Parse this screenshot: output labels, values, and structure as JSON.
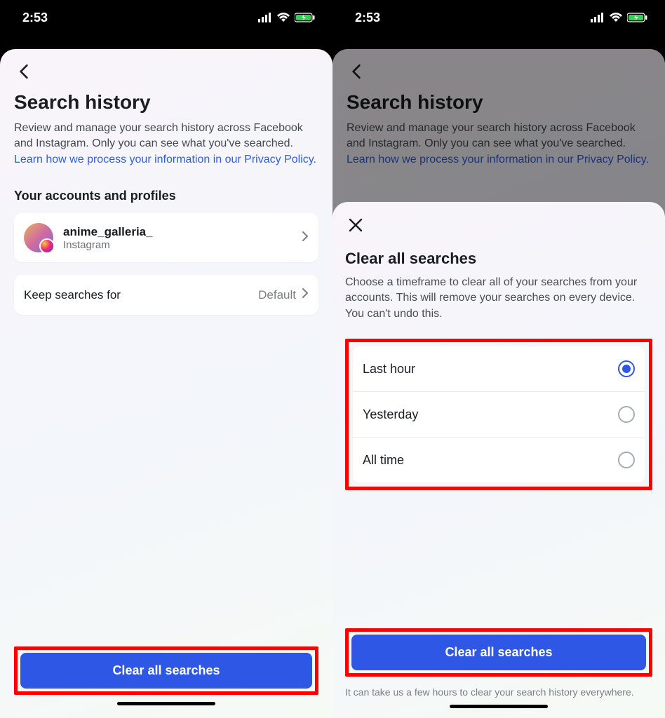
{
  "status": {
    "time": "2:53"
  },
  "screen1": {
    "title": "Search history",
    "desc_part1": "Review and manage your search history across Facebook and Instagram. Only you can see what you've searched. ",
    "desc_link": "Learn how we process your information in our Privacy Policy.",
    "section_title": "Your accounts and profiles",
    "account": {
      "name": "anime_galleria_",
      "platform": "Instagram"
    },
    "keep_searches_label": "Keep searches for",
    "keep_searches_value": "Default",
    "clear_button": "Clear all searches"
  },
  "screen2": {
    "title": "Search history",
    "desc_part1": "Review and manage your search history across Facebook and Instagram. Only you can see what you've searched. ",
    "desc_link": "Learn how we process your information in our Privacy Policy.",
    "modal": {
      "title": "Clear all searches",
      "desc": "Choose a timeframe to clear all of your searches from your accounts. This will remove your searches on every device. You can't undo this.",
      "options": {
        "opt1": "Last hour",
        "opt2": "Yesterday",
        "opt3": "All time"
      },
      "selected": "Last hour",
      "button": "Clear all searches",
      "footnote": "It can take us a few hours to clear your search history everywhere."
    }
  }
}
